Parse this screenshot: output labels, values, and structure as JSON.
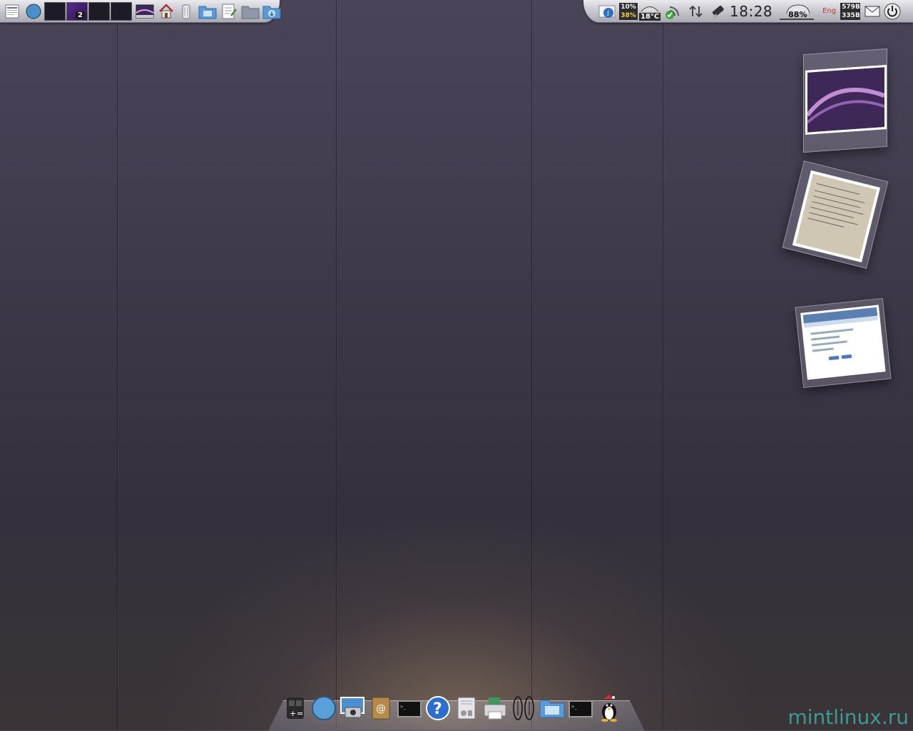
{
  "top_panel": {
    "workspace_switcher": {
      "workspaces": [
        "",
        "2",
        "",
        ""
      ],
      "active_index": 1
    },
    "cpu_label": "10%",
    "memory_label": "38%",
    "temperature_label": "18°C",
    "clock": "18:28",
    "battery_label": "88%",
    "keyboard_layout": "Eng",
    "net_down_label": "579B",
    "net_up_label": "335B"
  },
  "dock": {
    "items": [
      "calculator-icon",
      "compass-browser-icon",
      "photo-viewer-icon",
      "address-book-icon",
      "terminal-icon",
      "help-icon",
      "system-settings-icon",
      "print-manager-icon",
      "audio-icon",
      "folder-icon",
      "terminal-icon",
      "tux-icon"
    ]
  },
  "watermark": "mintlinux.ru",
  "colors": {
    "panel_top": "#e9e9ee",
    "panel_bottom": "#a9a9b3",
    "watermark": "#3cbeb4",
    "wallpaper": "#3d3849"
  }
}
